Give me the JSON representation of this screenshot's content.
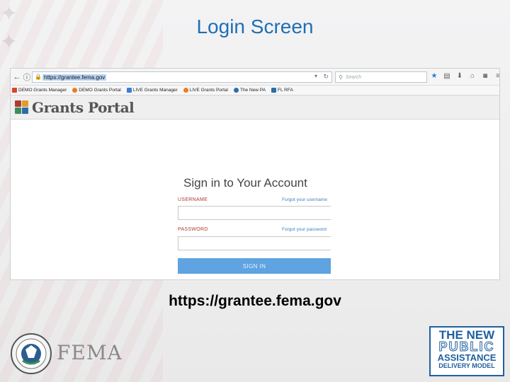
{
  "slide": {
    "title": "Login Screen",
    "caption_url": "https://grantee.fema.gov"
  },
  "browser": {
    "url": "https://grantee.fema.gov",
    "search_placeholder": "Search",
    "bookmarks": [
      {
        "label": "DEMO Grants Manager",
        "color": "#d9452c"
      },
      {
        "label": "DEMO Grants Portal",
        "color": "#e67e22"
      },
      {
        "label": "LIVE Grants Manager",
        "color": "#3b7dd8"
      },
      {
        "label": "LIVE Grants Portal",
        "color": "#e67e22"
      },
      {
        "label": "The New PA",
        "color": "#2c6eaa"
      },
      {
        "label": "FL RFA",
        "color": "#2c6eaa"
      }
    ]
  },
  "portal": {
    "brand": "Grants Portal",
    "signin_title": "Sign in to Your Account",
    "username_label": "USERNAME",
    "forgot_username": "Forgot your username",
    "password_label": "PASSWORD",
    "forgot_password": "Forgot your password",
    "signin_button": "SIGN IN",
    "accent_color": "#5fa3e0"
  },
  "footer": {
    "agency": "FEMA",
    "badge_lines": [
      "THE NEW",
      "PUBLIC",
      "ASSISTANCE",
      "DELIVERY MODEL"
    ]
  }
}
